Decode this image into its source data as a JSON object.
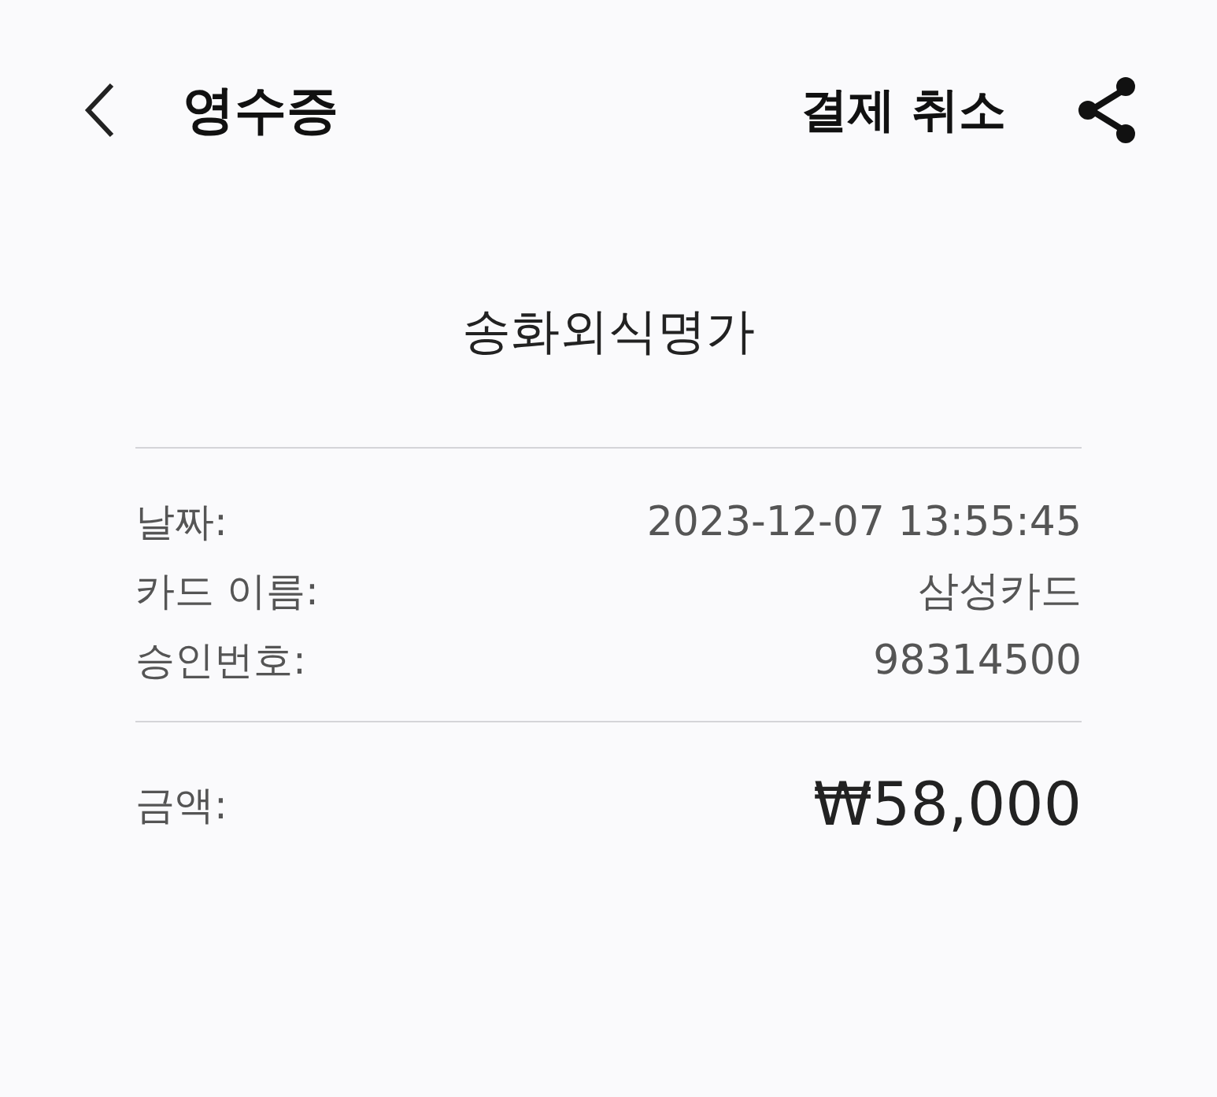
{
  "header": {
    "title": "영수증",
    "cancel_label": "결제 취소"
  },
  "store_name": "송화외식명가",
  "details": [
    {
      "label": "날짜:",
      "value": "2023-12-07 13:55:45"
    },
    {
      "label": "카드 이름:",
      "value": "삼성카드"
    },
    {
      "label": "승인번호:",
      "value": "98314500"
    }
  ],
  "total": {
    "label": "금액:",
    "value": "₩58,000"
  }
}
